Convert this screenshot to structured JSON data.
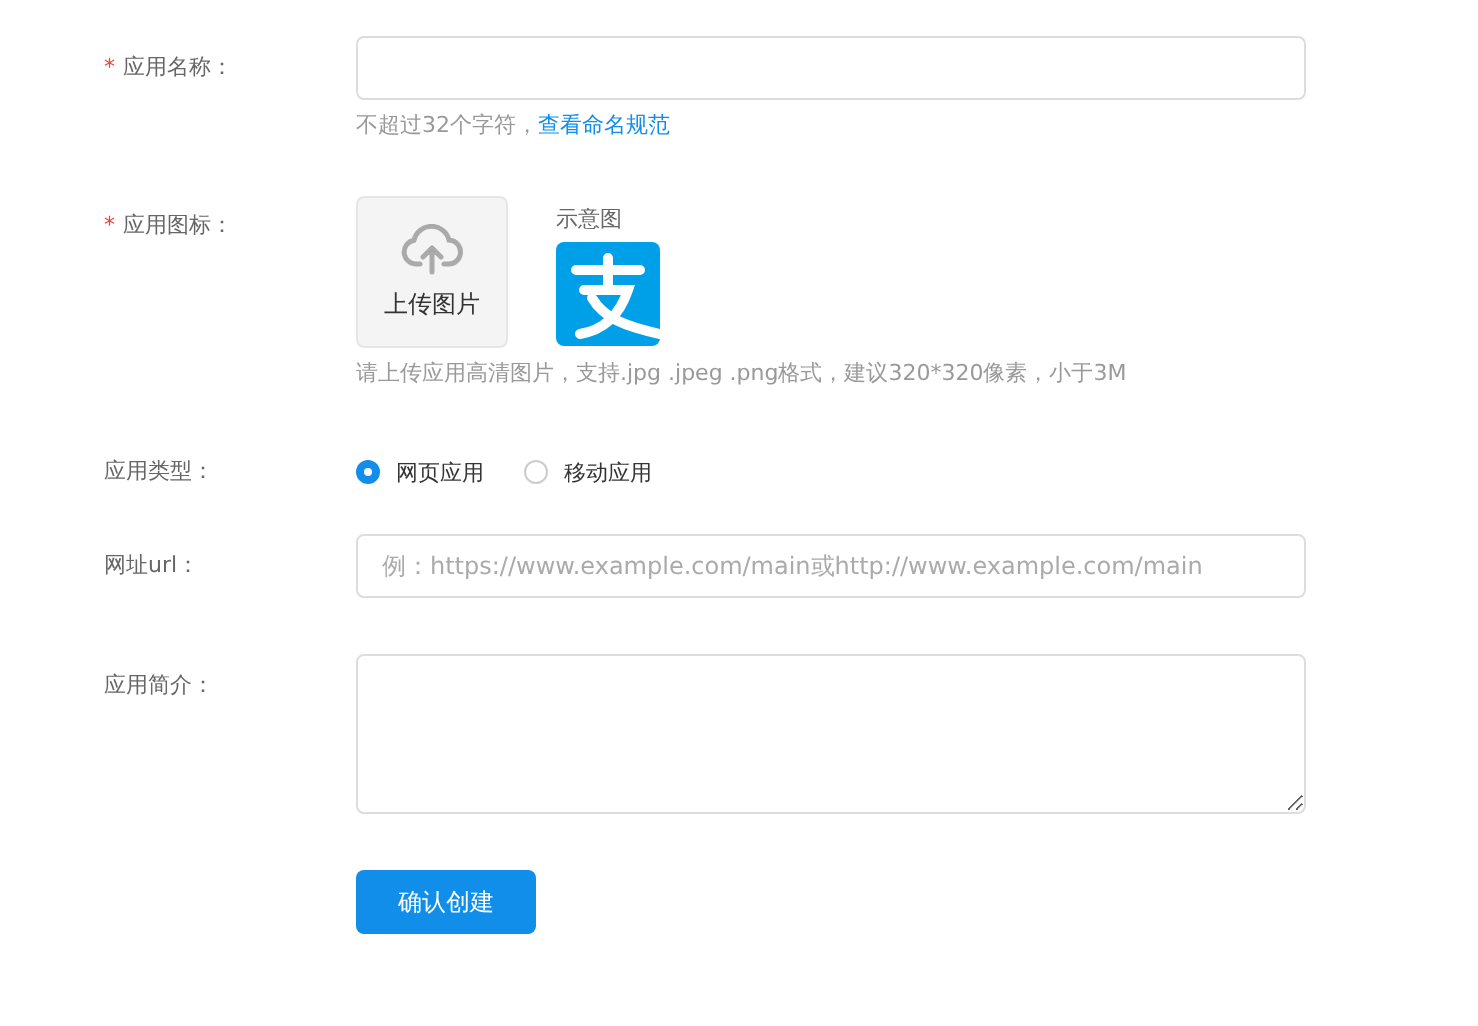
{
  "form": {
    "fields": [
      {
        "kind": "text",
        "required_mark": "*",
        "label": "应用名称：",
        "hint": "不超过32个字符，",
        "hint_link": "查看命名规范"
      },
      {
        "kind": "upload",
        "required_mark": "*",
        "label": "应用图标：",
        "upload_label": "上传图片",
        "sample_label": "示意图",
        "hint": "请上传应用高清图片，支持.jpg .jpeg .png格式，建议320*320像素，小于3M"
      },
      {
        "kind": "radio",
        "label": "应用类型：",
        "options": [
          {
            "label": "网页应用",
            "selected": true
          },
          {
            "label": "移动应用",
            "selected": false
          }
        ]
      },
      {
        "kind": "text",
        "label": "网址url：",
        "placeholder": "例：https://www.example.com/main或http://www.example.com/main"
      },
      {
        "kind": "textarea",
        "label": "应用简介："
      }
    ],
    "submit": "确认创建"
  }
}
